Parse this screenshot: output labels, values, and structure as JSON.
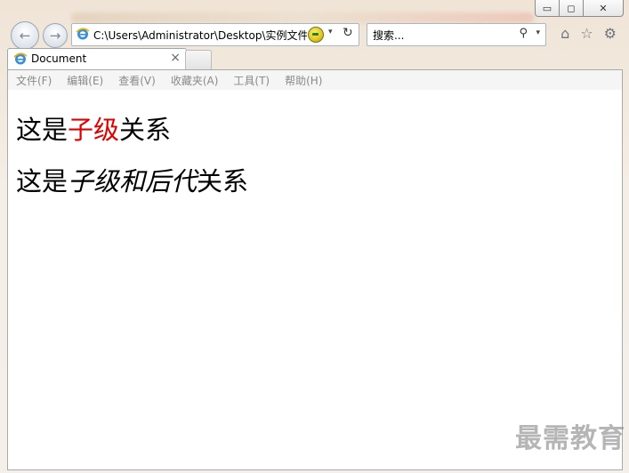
{
  "window": {
    "minimize_glyph": "▭",
    "maximize_glyph": "◻",
    "close_glyph": "✕"
  },
  "nav": {
    "back_glyph": "←",
    "forward_glyph": "→",
    "address": "C:\\Users\\Administrator\\Desktop\\实例文件",
    "address_dropdown": "▾",
    "refresh_glyph": "↻",
    "search_placeholder": "搜索...",
    "search_glyph": "⚲",
    "search_dropdown": "▾",
    "icons": [
      "home-icon",
      "favorites-star-icon",
      "tools-gear-icon"
    ],
    "home_glyph": "⌂",
    "star_glyph": "☆",
    "gear_glyph": "⚙"
  },
  "tab": {
    "title": "Document",
    "close_glyph": "×"
  },
  "menu": {
    "items": [
      "文件(F)",
      "编辑(E)",
      "查看(V)",
      "收藏夹(A)",
      "工具(T)",
      "帮助(H)"
    ]
  },
  "content": {
    "line1": {
      "prefix": "这是",
      "highlight": "子级",
      "suffix": "关系"
    },
    "line2": {
      "prefix": "这是",
      "italic": "子级和后代",
      "suffix": "关系"
    }
  },
  "watermark": "最需教育",
  "colors": {
    "accent_red": "#e00000",
    "menu_text": "#8a8a8a"
  }
}
